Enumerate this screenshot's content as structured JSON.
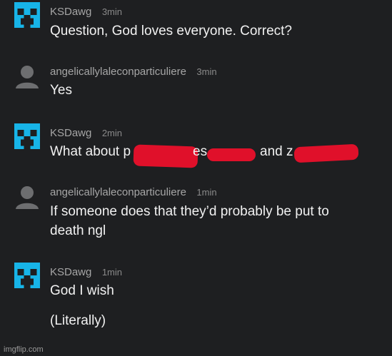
{
  "comments": [
    {
      "author": "KSDawg",
      "time": "3min",
      "avatar": "creeper-avatar",
      "lines": [
        "Question, God loves everyone. Correct?"
      ]
    },
    {
      "author": "angelicallylaleconparticuliere",
      "time": "3min",
      "avatar": "default-user-avatar",
      "lines": [
        "Yes"
      ]
    },
    {
      "author": "KSDawg",
      "time": "2min",
      "avatar": "creeper-avatar",
      "lines": [
        "What about p",
        "es",
        "and z"
      ]
    },
    {
      "author": "angelicallylaleconparticuliere",
      "time": "1min",
      "avatar": "default-user-avatar",
      "lines": [
        "If someone does that they’d probably be put to",
        "death ngl"
      ]
    },
    {
      "author": "KSDawg",
      "time": "1min",
      "avatar": "creeper-avatar",
      "lines": [
        "God I wish",
        "(Literally)"
      ]
    }
  ],
  "watermark": "imgflip.com",
  "colors": {
    "background": "#1e1f21",
    "creeper": "#17b4e8",
    "redaction": "#e0102a",
    "text": "#f1f1f1",
    "meta": "#a6a6a6"
  }
}
